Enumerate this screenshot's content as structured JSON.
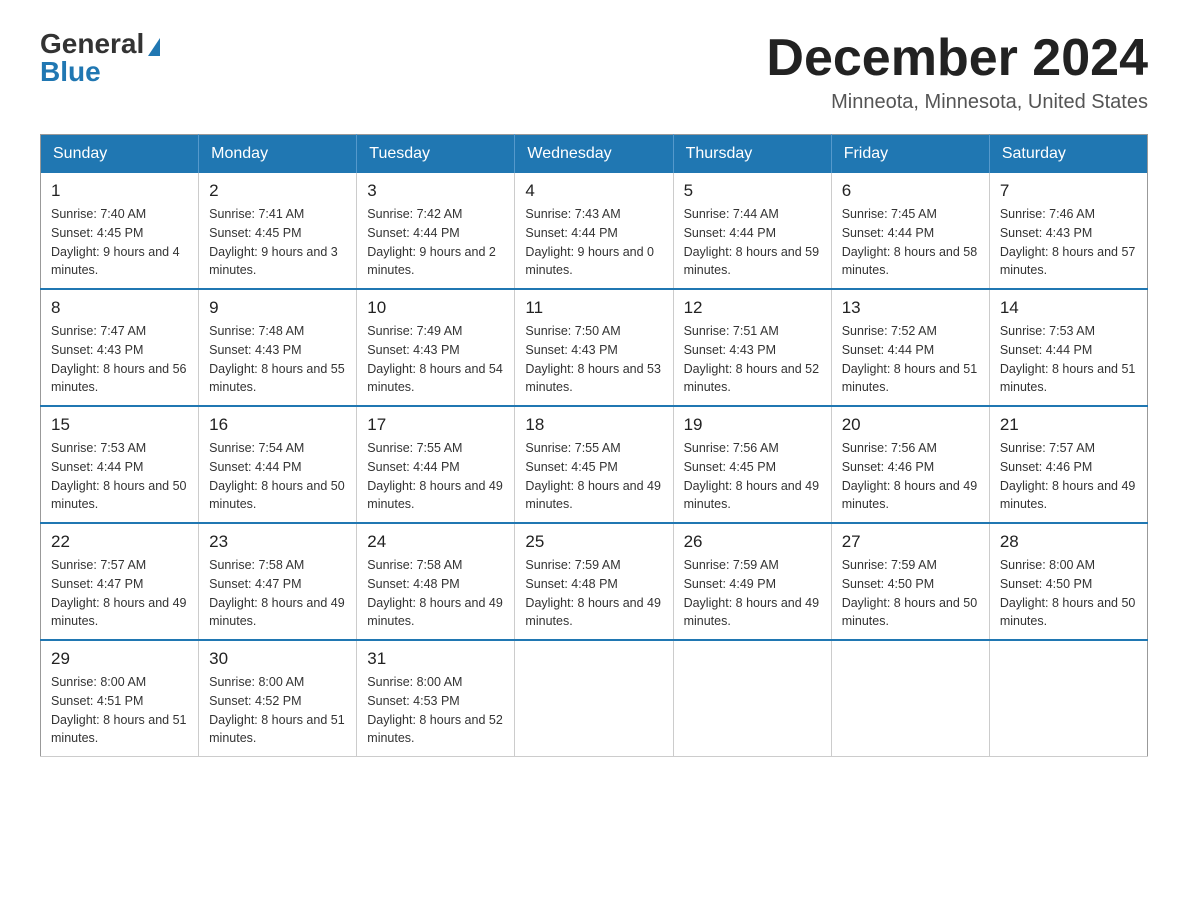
{
  "header": {
    "logo_general": "General",
    "logo_blue": "Blue",
    "month": "December 2024",
    "location": "Minneota, Minnesota, United States"
  },
  "days_of_week": [
    "Sunday",
    "Monday",
    "Tuesday",
    "Wednesday",
    "Thursday",
    "Friday",
    "Saturday"
  ],
  "weeks": [
    [
      {
        "day": "1",
        "sunrise": "7:40 AM",
        "sunset": "4:45 PM",
        "daylight": "9 hours and 4 minutes."
      },
      {
        "day": "2",
        "sunrise": "7:41 AM",
        "sunset": "4:45 PM",
        "daylight": "9 hours and 3 minutes."
      },
      {
        "day": "3",
        "sunrise": "7:42 AM",
        "sunset": "4:44 PM",
        "daylight": "9 hours and 2 minutes."
      },
      {
        "day": "4",
        "sunrise": "7:43 AM",
        "sunset": "4:44 PM",
        "daylight": "9 hours and 0 minutes."
      },
      {
        "day": "5",
        "sunrise": "7:44 AM",
        "sunset": "4:44 PM",
        "daylight": "8 hours and 59 minutes."
      },
      {
        "day": "6",
        "sunrise": "7:45 AM",
        "sunset": "4:44 PM",
        "daylight": "8 hours and 58 minutes."
      },
      {
        "day": "7",
        "sunrise": "7:46 AM",
        "sunset": "4:43 PM",
        "daylight": "8 hours and 57 minutes."
      }
    ],
    [
      {
        "day": "8",
        "sunrise": "7:47 AM",
        "sunset": "4:43 PM",
        "daylight": "8 hours and 56 minutes."
      },
      {
        "day": "9",
        "sunrise": "7:48 AM",
        "sunset": "4:43 PM",
        "daylight": "8 hours and 55 minutes."
      },
      {
        "day": "10",
        "sunrise": "7:49 AM",
        "sunset": "4:43 PM",
        "daylight": "8 hours and 54 minutes."
      },
      {
        "day": "11",
        "sunrise": "7:50 AM",
        "sunset": "4:43 PM",
        "daylight": "8 hours and 53 minutes."
      },
      {
        "day": "12",
        "sunrise": "7:51 AM",
        "sunset": "4:43 PM",
        "daylight": "8 hours and 52 minutes."
      },
      {
        "day": "13",
        "sunrise": "7:52 AM",
        "sunset": "4:44 PM",
        "daylight": "8 hours and 51 minutes."
      },
      {
        "day": "14",
        "sunrise": "7:53 AM",
        "sunset": "4:44 PM",
        "daylight": "8 hours and 51 minutes."
      }
    ],
    [
      {
        "day": "15",
        "sunrise": "7:53 AM",
        "sunset": "4:44 PM",
        "daylight": "8 hours and 50 minutes."
      },
      {
        "day": "16",
        "sunrise": "7:54 AM",
        "sunset": "4:44 PM",
        "daylight": "8 hours and 50 minutes."
      },
      {
        "day": "17",
        "sunrise": "7:55 AM",
        "sunset": "4:44 PM",
        "daylight": "8 hours and 49 minutes."
      },
      {
        "day": "18",
        "sunrise": "7:55 AM",
        "sunset": "4:45 PM",
        "daylight": "8 hours and 49 minutes."
      },
      {
        "day": "19",
        "sunrise": "7:56 AM",
        "sunset": "4:45 PM",
        "daylight": "8 hours and 49 minutes."
      },
      {
        "day": "20",
        "sunrise": "7:56 AM",
        "sunset": "4:46 PM",
        "daylight": "8 hours and 49 minutes."
      },
      {
        "day": "21",
        "sunrise": "7:57 AM",
        "sunset": "4:46 PM",
        "daylight": "8 hours and 49 minutes."
      }
    ],
    [
      {
        "day": "22",
        "sunrise": "7:57 AM",
        "sunset": "4:47 PM",
        "daylight": "8 hours and 49 minutes."
      },
      {
        "day": "23",
        "sunrise": "7:58 AM",
        "sunset": "4:47 PM",
        "daylight": "8 hours and 49 minutes."
      },
      {
        "day": "24",
        "sunrise": "7:58 AM",
        "sunset": "4:48 PM",
        "daylight": "8 hours and 49 minutes."
      },
      {
        "day": "25",
        "sunrise": "7:59 AM",
        "sunset": "4:48 PM",
        "daylight": "8 hours and 49 minutes."
      },
      {
        "day": "26",
        "sunrise": "7:59 AM",
        "sunset": "4:49 PM",
        "daylight": "8 hours and 49 minutes."
      },
      {
        "day": "27",
        "sunrise": "7:59 AM",
        "sunset": "4:50 PM",
        "daylight": "8 hours and 50 minutes."
      },
      {
        "day": "28",
        "sunrise": "8:00 AM",
        "sunset": "4:50 PM",
        "daylight": "8 hours and 50 minutes."
      }
    ],
    [
      {
        "day": "29",
        "sunrise": "8:00 AM",
        "sunset": "4:51 PM",
        "daylight": "8 hours and 51 minutes."
      },
      {
        "day": "30",
        "sunrise": "8:00 AM",
        "sunset": "4:52 PM",
        "daylight": "8 hours and 51 minutes."
      },
      {
        "day": "31",
        "sunrise": "8:00 AM",
        "sunset": "4:53 PM",
        "daylight": "8 hours and 52 minutes."
      },
      null,
      null,
      null,
      null
    ]
  ],
  "labels": {
    "sunrise": "Sunrise:",
    "sunset": "Sunset:",
    "daylight": "Daylight:"
  }
}
